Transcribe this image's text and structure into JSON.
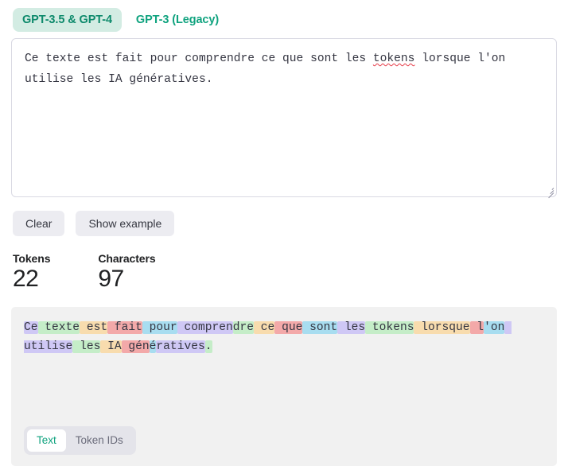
{
  "model_tabs": [
    {
      "label": "GPT-3.5 & GPT-4",
      "active": true
    },
    {
      "label": "GPT-3 (Legacy)",
      "active": false
    }
  ],
  "editor": {
    "value_before_misspell": "Ce texte est fait pour comprendre ce que sont les ",
    "misspelled_word": "tokens",
    "value_after_misspell": " lorsque l'on utilise les IA génératives."
  },
  "actions": {
    "clear_label": "Clear",
    "show_example_label": "Show example"
  },
  "stats": [
    {
      "label": "Tokens",
      "value": "22"
    },
    {
      "label": "Characters",
      "value": "97"
    }
  ],
  "output_tabs": [
    {
      "label": "Text",
      "active": true
    },
    {
      "label": "Token IDs",
      "active": false
    }
  ],
  "palette": {
    "purple": "#cfc8f5",
    "green": "#c5edc8",
    "orange": "#f8dcae",
    "pink": "#f3a9a9",
    "cyan": "#a8ddf0",
    "panel_bg": "#f1f1f1",
    "accent": "#10a37f",
    "active_tab_bg": "#d3ece3",
    "button_bg": "#ececf1"
  },
  "tokens": [
    {
      "text": "Ce",
      "color": "#cfc8f5"
    },
    {
      "text": " texte",
      "color": "#c5edc8"
    },
    {
      "text": " est",
      "color": "#f8dcae"
    },
    {
      "text": " fait",
      "color": "#f3a9a9"
    },
    {
      "text": " pour",
      "color": "#a8ddf0"
    },
    {
      "text": " compren",
      "color": "#cfc8f5"
    },
    {
      "text": "dre",
      "color": "#c5edc8"
    },
    {
      "text": " ce",
      "color": "#f8dcae"
    },
    {
      "text": " que",
      "color": "#f3a9a9"
    },
    {
      "text": " sont",
      "color": "#a8ddf0"
    },
    {
      "text": " les",
      "color": "#cfc8f5"
    },
    {
      "text": " tokens",
      "color": "#c5edc8"
    },
    {
      "text": " lorsque",
      "color": "#f8dcae"
    },
    {
      "text": " l",
      "color": "#f3a9a9"
    },
    {
      "text": "'on",
      "color": "#a8ddf0"
    },
    {
      "text": " utilise",
      "color": "#cfc8f5"
    },
    {
      "text": " les",
      "color": "#c5edc8"
    },
    {
      "text": " IA",
      "color": "#f8dcae"
    },
    {
      "text": " gén",
      "color": "#f3a9a9"
    },
    {
      "text": "é",
      "color": "#a8ddf0"
    },
    {
      "text": "ratives",
      "color": "#cfc8f5"
    },
    {
      "text": ".",
      "color": "#c5edc8"
    }
  ]
}
